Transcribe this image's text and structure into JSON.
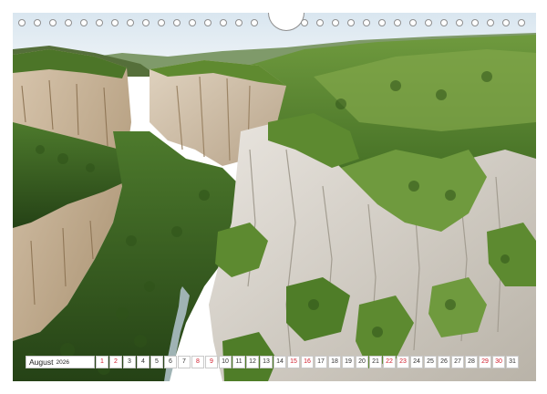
{
  "calendar": {
    "month": "August",
    "year": "2026",
    "days": [
      {
        "d": "1",
        "we": true
      },
      {
        "d": "2",
        "we": true
      },
      {
        "d": "3",
        "we": false
      },
      {
        "d": "4",
        "we": false
      },
      {
        "d": "5",
        "we": false
      },
      {
        "d": "6",
        "we": false
      },
      {
        "d": "7",
        "we": false
      },
      {
        "d": "8",
        "we": true
      },
      {
        "d": "9",
        "we": true
      },
      {
        "d": "10",
        "we": false
      },
      {
        "d": "11",
        "we": false
      },
      {
        "d": "12",
        "we": false
      },
      {
        "d": "13",
        "we": false
      },
      {
        "d": "14",
        "we": false
      },
      {
        "d": "15",
        "we": true
      },
      {
        "d": "16",
        "we": true
      },
      {
        "d": "17",
        "we": false
      },
      {
        "d": "18",
        "we": false
      },
      {
        "d": "19",
        "we": false
      },
      {
        "d": "20",
        "we": false
      },
      {
        "d": "21",
        "we": false
      },
      {
        "d": "22",
        "we": true
      },
      {
        "d": "23",
        "we": true
      },
      {
        "d": "24",
        "we": false
      },
      {
        "d": "25",
        "we": false
      },
      {
        "d": "26",
        "we": false
      },
      {
        "d": "27",
        "we": false
      },
      {
        "d": "28",
        "we": false
      },
      {
        "d": "29",
        "we": true
      },
      {
        "d": "30",
        "we": true
      },
      {
        "d": "31",
        "we": false
      }
    ],
    "weekend_color": "#d0202e"
  },
  "photo": {
    "subject": "canyon-landscape"
  }
}
